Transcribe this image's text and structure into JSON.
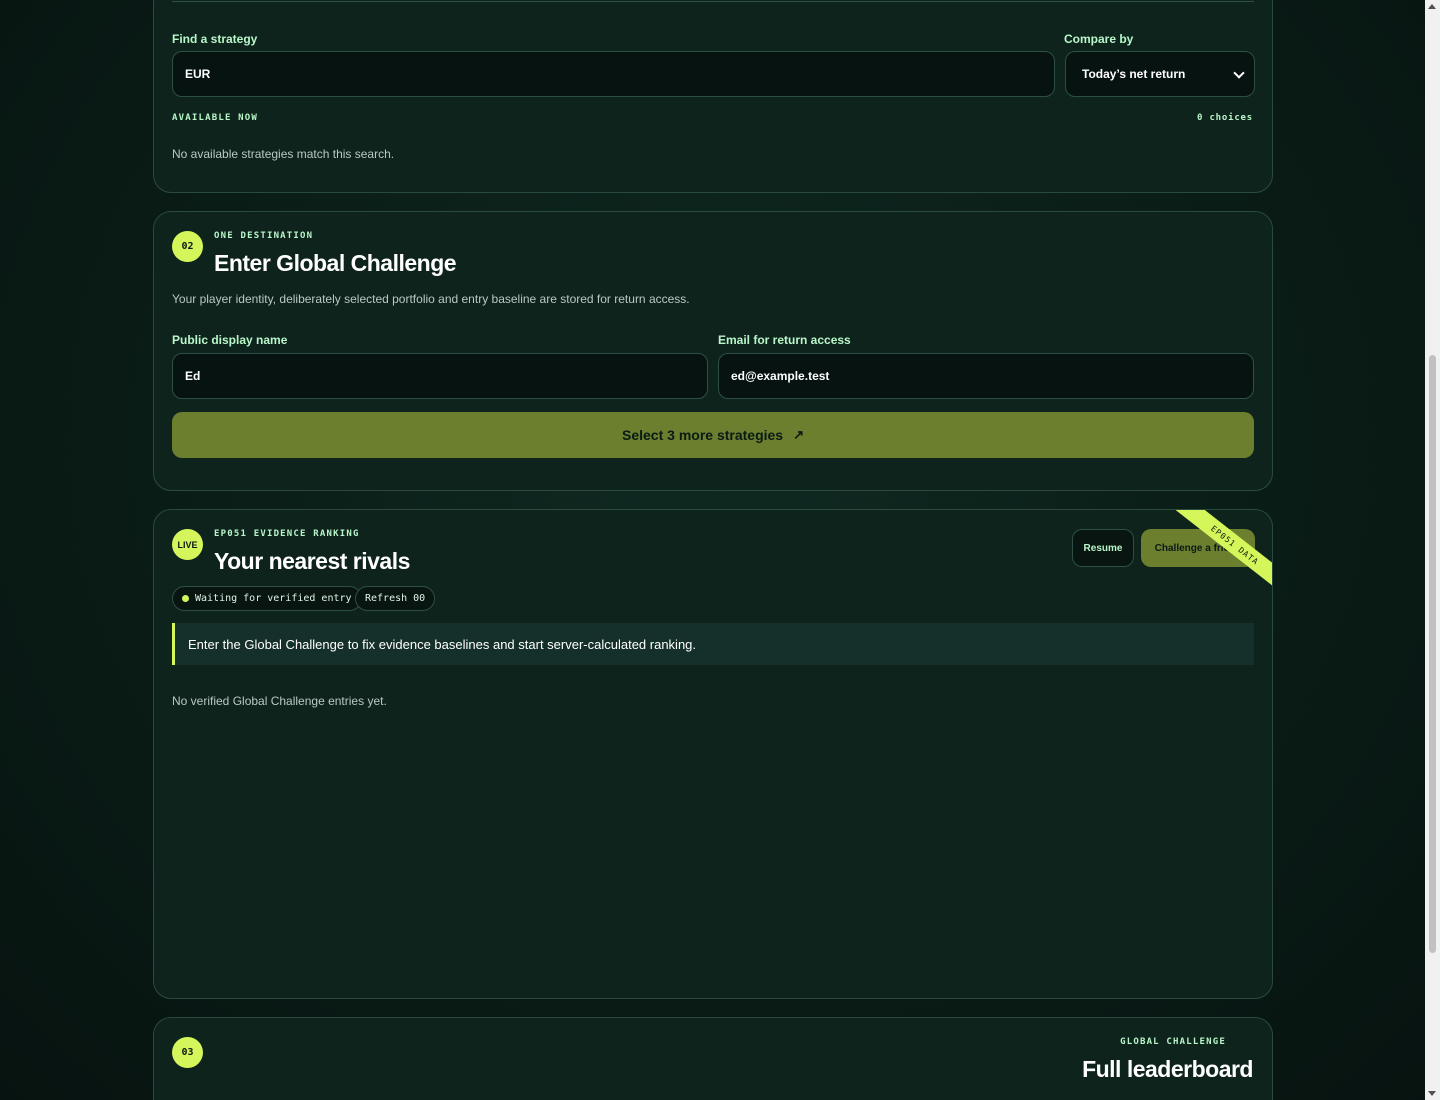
{
  "search_card": {
    "find_label": "Find a strategy",
    "find_value": "EUR",
    "compare_label": "Compare by",
    "compare_value": "Today’s net return",
    "available_label": "AVAILABLE NOW",
    "choices_count": "0 choices",
    "empty_message": "No available strategies match this search."
  },
  "entry_card": {
    "step": "02",
    "eyebrow": "ONE DESTINATION",
    "title": "Enter Global Challenge",
    "description": "Your player identity, deliberately selected portfolio and entry baseline are stored for return access.",
    "name_label": "Public display name",
    "name_value": "Ed",
    "email_label": "Email for return access",
    "email_value": "ed@example.test",
    "submit_label": "Select 3 more strategies",
    "submit_icon": "arrow-up-right-icon"
  },
  "rivals_card": {
    "badge": "LIVE",
    "eyebrow": "EP051 EVIDENCE RANKING",
    "title": "Your nearest rivals",
    "resume_label": "Resume",
    "challenge_label": "Challenge a friend",
    "ribbon": "EP051 DATA",
    "status_pill": "Waiting for verified entry",
    "refresh_pill": "Refresh 00",
    "notice": "Enter the Global Challenge to fix evidence baselines and start server-calculated ranking.",
    "empty_message": "No verified Global Challenge entries yet."
  },
  "leaderboard_card": {
    "step": "03",
    "eyebrow": "GLOBAL CHALLENGE",
    "title": "Full leaderboard"
  },
  "colors": {
    "accent": "#d4f65a",
    "button_bg": "#6b7f2e",
    "card_bg": "#0f231d",
    "border": "#2a4a3d"
  }
}
